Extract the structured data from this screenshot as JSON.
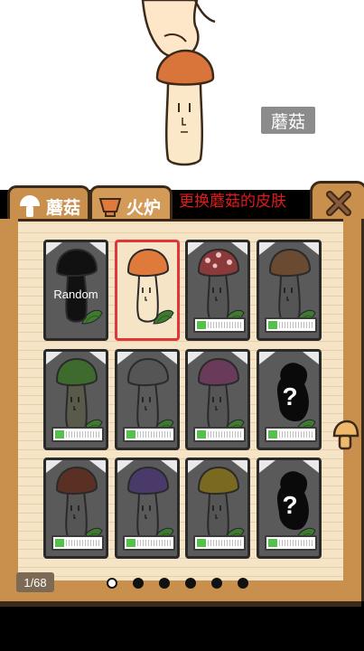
{
  "preview": {
    "name": "蘑菇"
  },
  "tabs": [
    {
      "label": "蘑菇",
      "icon": "mushroom-icon"
    },
    {
      "label": "火炉",
      "icon": "pot-icon"
    }
  ],
  "hint": "更换蘑菇的皮肤",
  "close_icon": "close-x-icon",
  "cards": [
    {
      "type": "random",
      "label": "Random",
      "cap": "#111111",
      "stem": "#111111",
      "progress": null
    },
    {
      "type": "skin",
      "selected": true,
      "cap": "#e07a3a",
      "stem": "#f8e6c8",
      "progress": null
    },
    {
      "type": "skin",
      "cap": "#8a3a3a",
      "stem": "#555555",
      "spots": true,
      "progress": 0.2
    },
    {
      "type": "skin",
      "cap": "#6b4a32",
      "stem": "#555555",
      "progress": 0.2
    },
    {
      "type": "skin",
      "cap": "#3e6a2e",
      "stem": "#5a5a4a",
      "progress": 0.2
    },
    {
      "type": "skin",
      "cap": "#555555",
      "stem": "#5a5a5a",
      "progress": 0.2
    },
    {
      "type": "skin",
      "cap": "#6a3a5a",
      "stem": "#555555",
      "progress": 0.2
    },
    {
      "type": "locked",
      "label": "?",
      "progress": 0.2
    },
    {
      "type": "skin",
      "cap": "#5a3025",
      "stem": "#555555",
      "progress": 0.2
    },
    {
      "type": "skin",
      "cap": "#4a3a6a",
      "stem": "#5a5a5a",
      "progress": 0.2
    },
    {
      "type": "skin",
      "cap": "#7a6a20",
      "stem": "#555555",
      "progress": 0.2
    },
    {
      "type": "locked",
      "label": "?",
      "progress": 0.2
    }
  ],
  "page_indicator": "1/68",
  "pagination": {
    "total": 6,
    "active": 0
  },
  "side_handle_icon": "mushroom-handle-icon"
}
